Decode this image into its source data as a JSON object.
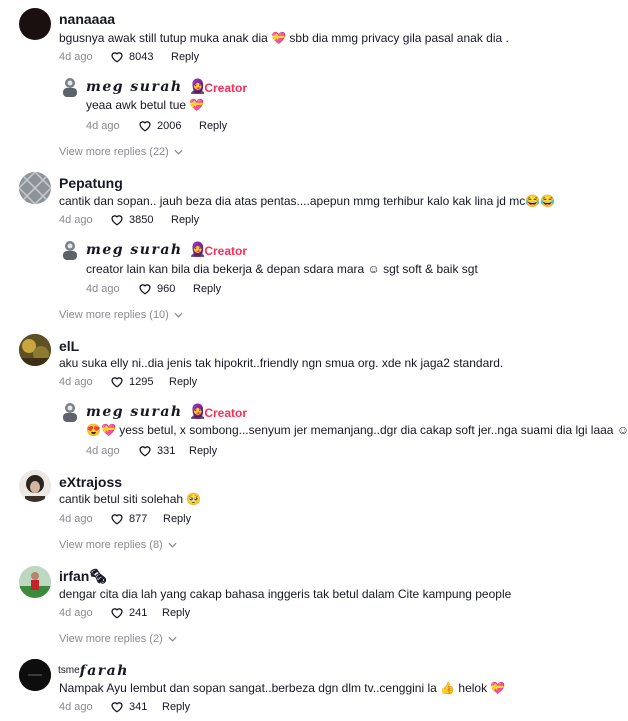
{
  "comments": [
    {
      "username": "nanaaaa",
      "text": "bgusnya awak still tutup muka anak dia 💝 sbb dia mmg privacy gila pasal anak dia .",
      "date": "4d ago",
      "likes": "8043",
      "reply_label": "Reply",
      "replies": [
        {
          "username": "meg surah",
          "emoji": "🧕",
          "badge": "· Creator",
          "text": "yeaa awk betul tue 💝",
          "date": "4d ago",
          "likes": "2006",
          "reply_label": "Reply"
        }
      ],
      "view_more": "View more replies (22)"
    },
    {
      "username": "Pepatung",
      "text": "cantik dan sopan.. jauh beza dia atas pentas....apepun mmg terhibur kalo kak lina jd mc😂😂",
      "date": "4d ago",
      "likes": "3850",
      "reply_label": "Reply",
      "replies": [
        {
          "username": "meg surah",
          "emoji": "🧕",
          "badge": "· Creator",
          "text": "creator lain kan bila dia bekerja & depan sdara mara ☺ sgt soft & baik sgt",
          "date": "4d ago",
          "likes": "960",
          "reply_label": "Reply"
        }
      ],
      "view_more": "View more replies (10)"
    },
    {
      "username": "elL",
      "text": "aku suka elly ni..dia jenis tak hipokrit..friendly ngn smua org. xde nk jaga2 standard.",
      "date": "4d ago",
      "likes": "1295",
      "reply_label": "Reply",
      "replies": [
        {
          "username": "meg surah",
          "emoji": "🧕",
          "badge": "· Creator",
          "text": "😍💝 yess betul, x sombong...senyum jer memanjang..dgr dia cakap soft jer..nga suami dia lgi laaa ☺",
          "date": "4d ago",
          "likes": "331",
          "reply_label": "Reply"
        }
      ],
      "view_more": ""
    },
    {
      "username": "eXtrajoss",
      "text": "cantik betul siti solehah 🥺",
      "date": "4d ago",
      "likes": "877",
      "reply_label": "Reply",
      "replies": [],
      "view_more": "View more replies (8)"
    },
    {
      "username": "irfan🗞",
      "text": "dengar cita dia lah yang cakap bahasa inggeris tak betul dalam Cite kampung people",
      "date": "4d ago",
      "likes": "241",
      "reply_label": "Reply",
      "replies": [],
      "view_more": "View more replies (2)"
    },
    {
      "username_prefix": "tsme",
      "username": "farah",
      "text": "Nampak Ayu lembut dan sopan sangat..berbeza dgn dlm tv..cenggini la 👍 helok 💝",
      "date": "4d ago",
      "likes": "341",
      "reply_label": "Reply",
      "replies": [],
      "view_more": ""
    }
  ],
  "colors": {
    "creator": "#fe2c55",
    "muted": "#8a8b91",
    "text": "#161823"
  },
  "icons": {
    "like": "heart-outline-icon",
    "expand": "chevron-down-icon"
  }
}
